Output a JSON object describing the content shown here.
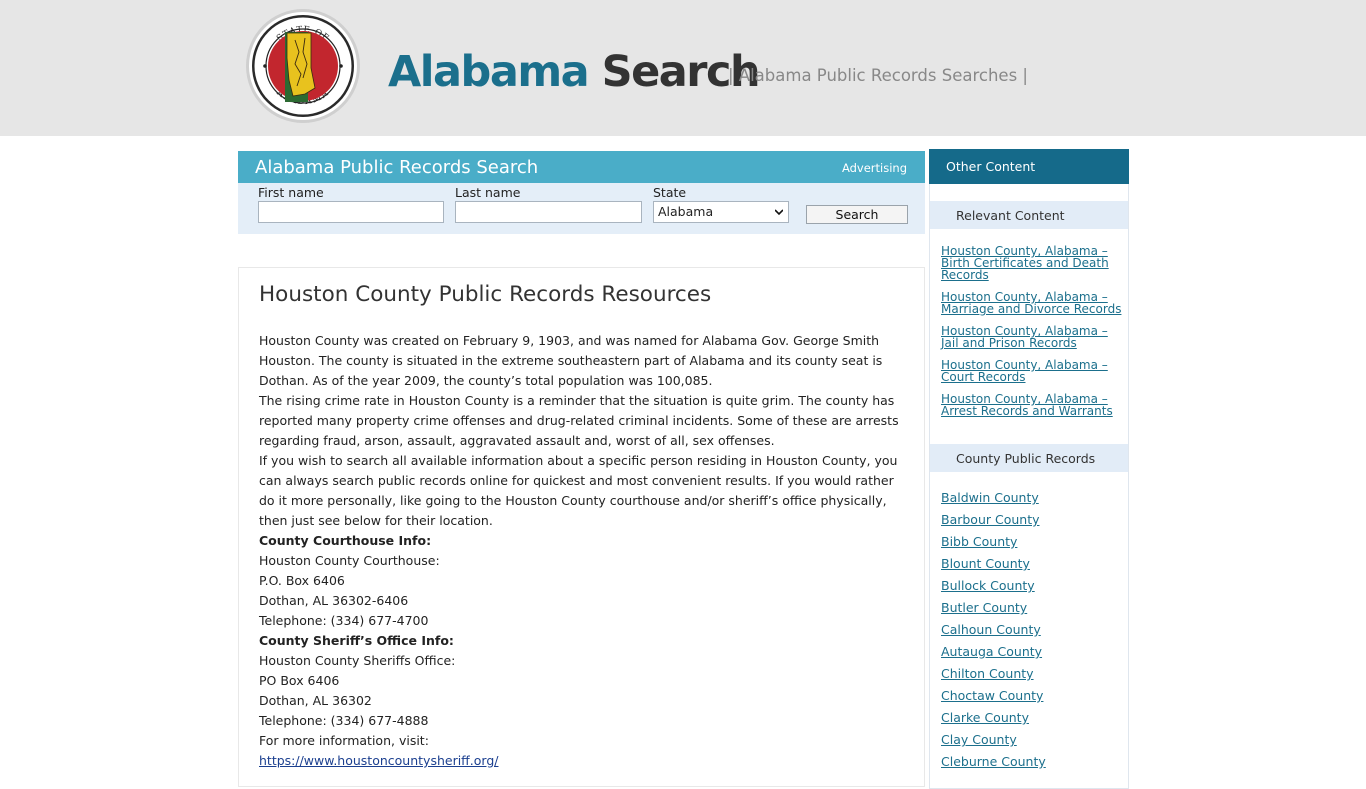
{
  "header": {
    "brand_word1": "Alabama",
    "brand_word2": "Search",
    "tagline": "| Alabama Public Records Searches |",
    "seal_text_top": "STATE OF",
    "seal_text_bottom": "ALABAMA"
  },
  "search": {
    "title": "Alabama Public Records Search",
    "advertising_label": "Advertising",
    "first_name_label": "First name",
    "last_name_label": "Last name",
    "state_label": "State",
    "first_name_value": "",
    "last_name_value": "",
    "state_value": "Alabama",
    "button_label": "Search"
  },
  "article": {
    "title": "Houston County Public Records Resources",
    "paragraphs": [
      "Houston County was created on February 9, 1903, and was named for Alabama Gov. George Smith Houston. The county is situated in the extreme southeastern part of Alabama and its county seat is Dothan. As of the year 2009, the county’s total population was 100,085.",
      "The rising crime rate in Houston County is a reminder that the situation is quite grim. The county has reported many property crime offenses and drug-related criminal incidents. Some of these are arrests regarding fraud, arson, assault, aggravated assault and, worst of all, sex offenses.",
      "If you wish to search all available information about a specific person residing in Houston County, you can always search public records online for quickest and most convenient results. If you would rather do it more personally, like going to the Houston County courthouse and/or sheriff’s office physically, then just see below for their location."
    ],
    "courthouse_heading": "County Courthouse Info:",
    "courthouse_lines": [
      "Houston County Courthouse:",
      "P.O. Box 6406",
      "Dothan, AL 36302-6406",
      "Telephone: (334) 677-4700"
    ],
    "sheriff_heading": "County Sheriff’s Office Info:",
    "sheriff_lines": [
      "Houston County Sheriffs Office:",
      "PO Box 6406",
      "Dothan, AL 36302",
      "Telephone: (334) 677-4888"
    ],
    "more_info": "For more information, visit:",
    "link": "https://www.houstoncountysheriff.org/"
  },
  "sidebar": {
    "heading": "Other Content",
    "relevant_heading": "Relevant Content",
    "relevant_links": [
      "Houston County, Alabama – Birth Certificates and Death Records",
      "Houston County, Alabama – Marriage and Divorce Records",
      "Houston County, Alabama – Jail and Prison Records",
      "Houston County, Alabama – Court Records",
      "Houston County, Alabama – Arrest Records and Warrants"
    ],
    "county_heading": "County Public Records",
    "county_links": [
      "Baldwin County",
      "Barbour County",
      "Bibb County",
      "Blount County",
      "Bullock County",
      "Butler County",
      "Calhoun County",
      "Autauga County",
      "Chilton County",
      "Choctaw County",
      "Clarke County",
      "Clay County",
      "Cleburne County"
    ]
  },
  "colors": {
    "brand_blue": "#1b6f8c",
    "brand_dark": "#333333",
    "search_bar": "#4aadc8",
    "sidebar_head": "#156a8a",
    "panel_bg": "#e4eef8"
  }
}
